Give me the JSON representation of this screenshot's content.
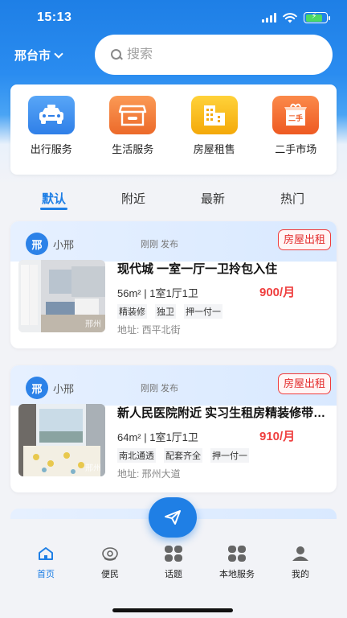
{
  "status": {
    "time": "15:13"
  },
  "header": {
    "city": "邢台市",
    "search_placeholder": "搜索"
  },
  "services": [
    {
      "label": "出行服务",
      "icon": "car-icon",
      "color": "#3b8ff0"
    },
    {
      "label": "生活服务",
      "icon": "shop-icon",
      "color": "#f07a3a"
    },
    {
      "label": "房屋租售",
      "icon": "building-icon",
      "color": "#f5b50c"
    },
    {
      "label": "二手市场",
      "icon": "second-hand-box-icon",
      "color": "#f26b2e"
    }
  ],
  "tabs": [
    "默认",
    "附近",
    "最新",
    "热门"
  ],
  "active_tab": "默认",
  "listings": [
    {
      "avatar_text": "邢",
      "author": "小邢",
      "posted": "刚刚 发布",
      "badge": "房屋出租",
      "title": "现代城 一室一厅一卫拎包入住",
      "spec": "56m² | 1室1厅1卫",
      "price": "900/月",
      "tags": [
        "精装修",
        "独卫",
        "押一付一"
      ],
      "address": "地址: 西平北街",
      "watermark": "邢州"
    },
    {
      "avatar_text": "邢",
      "author": "小邢",
      "posted": "刚刚 发布",
      "badge": "房屋出租",
      "title": "新人民医院附近 实习生租房精装修带阳台",
      "spec": "64m² | 1室1厅1卫",
      "price": "910/月",
      "tags": [
        "南北通透",
        "配套齐全",
        "押一付一"
      ],
      "address": "地址: 邢州大道",
      "watermark": "邢州"
    }
  ],
  "nav": [
    {
      "label": "首页",
      "icon": "home-icon",
      "active": true
    },
    {
      "label": "便民",
      "icon": "convenience-icon",
      "active": false
    },
    {
      "label": "话题",
      "icon": "topic-grid-icon",
      "active": false
    },
    {
      "label": "本地服务",
      "icon": "local-service-grid-icon",
      "active": false
    },
    {
      "label": "我的",
      "icon": "profile-icon",
      "active": false
    }
  ],
  "colors": {
    "brand": "#1f7fe5",
    "price": "#ef4040",
    "badge": "#e32b2b"
  }
}
